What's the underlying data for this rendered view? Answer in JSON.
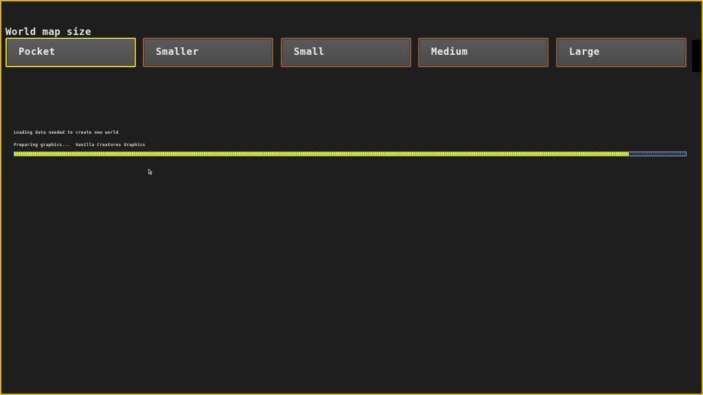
{
  "world_map_size": {
    "title": "World map size",
    "options": [
      {
        "label": "Pocket",
        "selected": true
      },
      {
        "label": "Smaller",
        "selected": false
      },
      {
        "label": "Small",
        "selected": false
      },
      {
        "label": "Medium",
        "selected": false
      },
      {
        "label": "Large",
        "selected": false
      }
    ]
  },
  "loading": {
    "message": "Loading data needed to create new world",
    "status": "Preparing graphics...  Vanilla Creatures Graphics",
    "progress": 0.915
  },
  "colors": {
    "frame_border": "#d9b51c",
    "selected_border": "#e0cf2a",
    "button_border": "#8a5a3a",
    "progress_fill": "#d4e84a",
    "progress_track_border": "#5fb8d8"
  },
  "icons": {
    "cursor": "mouse-pointer-icon"
  }
}
